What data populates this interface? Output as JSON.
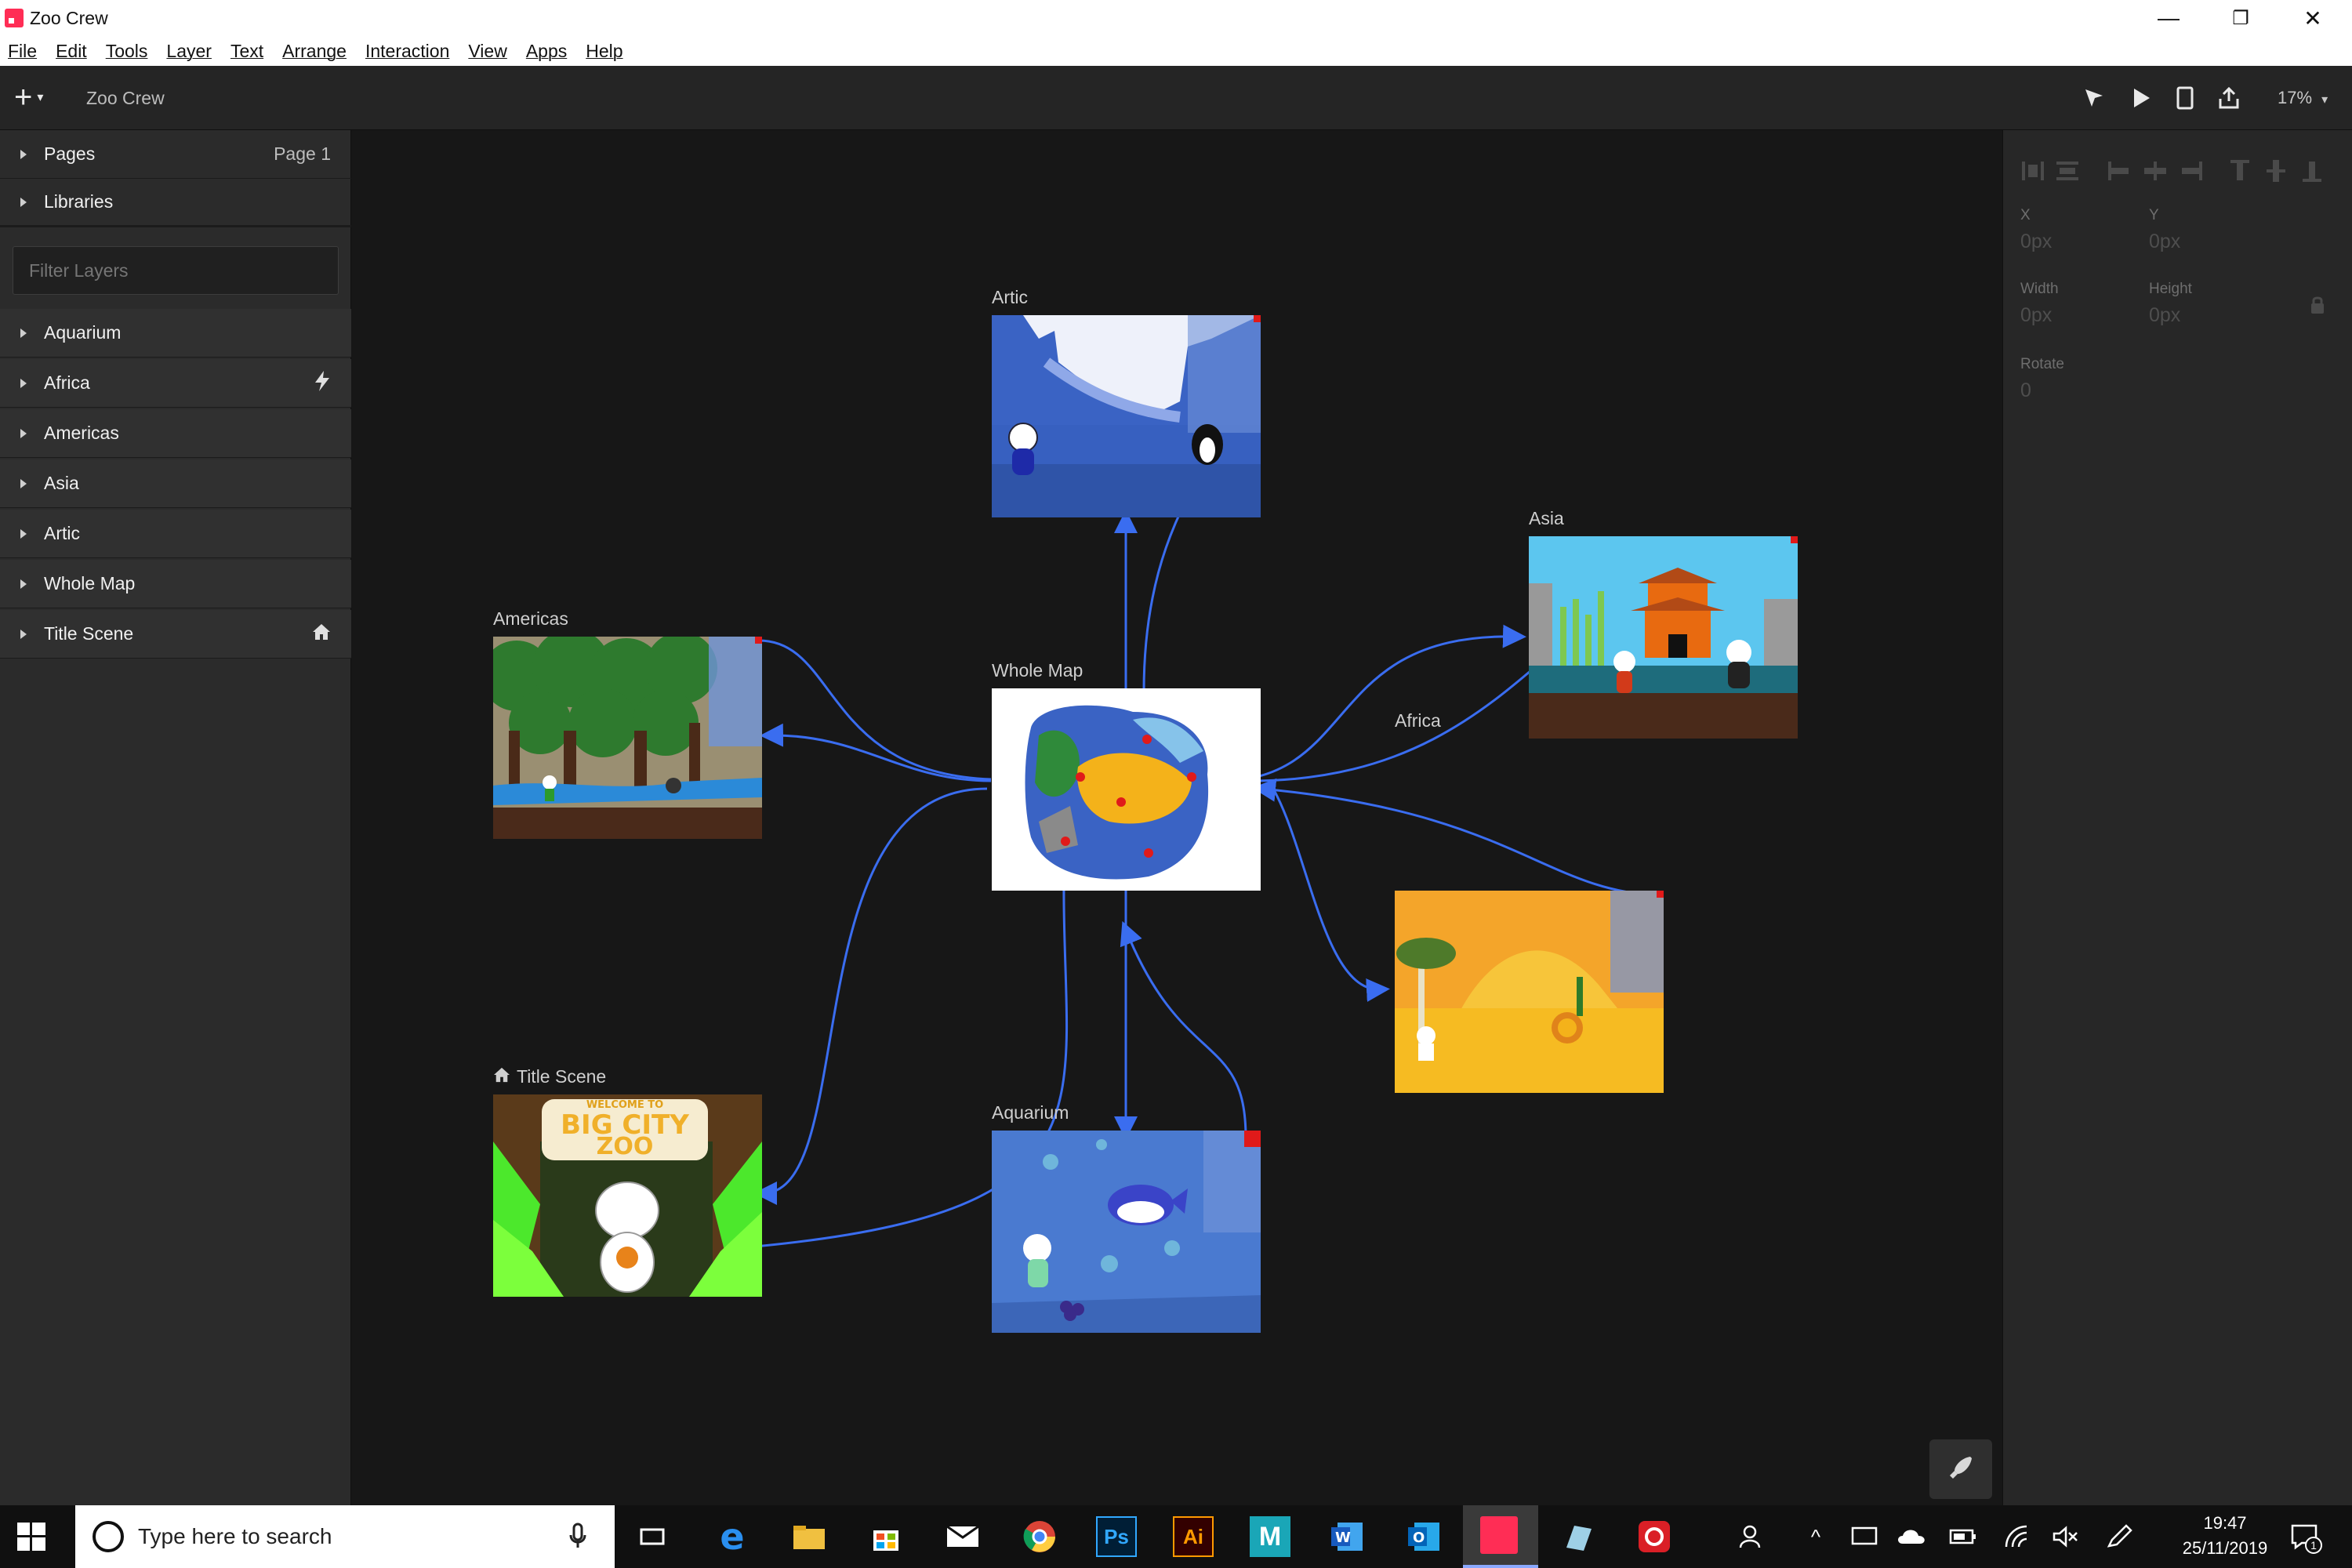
{
  "window": {
    "title": "Zoo Crew",
    "minimize": "—",
    "maximize": "❐",
    "close": "✕"
  },
  "menu": [
    "File",
    "Edit",
    "Tools",
    "Layer",
    "Text",
    "Arrange",
    "Interaction",
    "View",
    "Apps",
    "Help"
  ],
  "toolbar": {
    "add": "+",
    "doc_title": "Zoo Crew",
    "zoom": "17%"
  },
  "left_panel": {
    "pages_label": "Pages",
    "pages_value": "Page 1",
    "libraries_label": "Libraries",
    "filter_placeholder": "Filter Layers",
    "layers": [
      {
        "label": "Aquarium",
        "icon": ""
      },
      {
        "label": "Africa",
        "icon": "lightning-icon"
      },
      {
        "label": "Americas",
        "icon": ""
      },
      {
        "label": "Asia",
        "icon": ""
      },
      {
        "label": "Artic",
        "icon": ""
      },
      {
        "label": "Whole Map",
        "icon": ""
      },
      {
        "label": "Title Scene",
        "icon": "home-icon"
      }
    ]
  },
  "artboards": {
    "artic": "Artic",
    "asia": "Asia",
    "americas": "Americas",
    "whole_map": "Whole Map",
    "africa": "Africa",
    "title_scene": "Title Scene",
    "aquarium": "Aquarium",
    "welcome_sign": "WELCOME TO",
    "zoo_name_1": "BIG CITY",
    "zoo_name_2": "ZOO"
  },
  "right_panel": {
    "x_label": "X",
    "x_value": "0px",
    "y_label": "Y",
    "y_value": "0px",
    "width_label": "Width",
    "width_value": "0px",
    "height_label": "Height",
    "height_value": "0px",
    "rotate_label": "Rotate",
    "rotate_value": "0"
  },
  "taskbar": {
    "search_placeholder": "Type here to search",
    "time": "19:47",
    "date": "25/11/2019",
    "notifications": "1"
  },
  "colors": {
    "accent": "#ff2d55",
    "link": "#3a6df0",
    "canvas": "#171717",
    "panel": "#2b2b2b"
  }
}
